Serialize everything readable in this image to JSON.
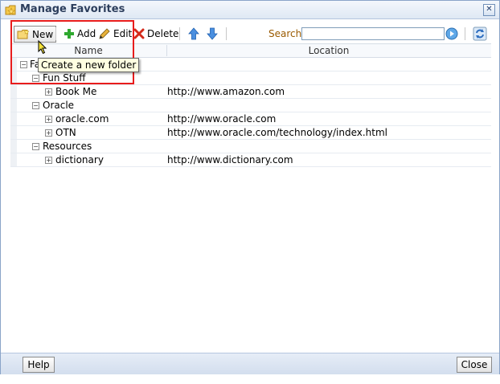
{
  "dialog": {
    "title": "Manage Favorites",
    "close_icon": "close-icon"
  },
  "toolbar": {
    "new_label": "New",
    "add_label": "Add",
    "edit_label": "Edit",
    "delete_label": "Delete",
    "search_label": "Search",
    "search_value": "",
    "icons": [
      "new-folder-icon",
      "add-icon",
      "edit-icon",
      "delete-icon",
      "move-up-icon",
      "move-down-icon",
      "go-icon",
      "refresh-icon"
    ]
  },
  "tooltip": {
    "text": "Create a new folder"
  },
  "table": {
    "headers": {
      "name": "Name",
      "location": "Location"
    },
    "root": {
      "name": "Fa",
      "toggle": "−"
    },
    "rows": [
      {
        "name": "Fun Stuff",
        "location": "",
        "toggle": "−",
        "level": 1
      },
      {
        "name": "Book Me",
        "location": "http://www.amazon.com",
        "toggle": "+",
        "level": 2
      },
      {
        "name": "Oracle",
        "location": "",
        "toggle": "−",
        "level": 1
      },
      {
        "name": "oracle.com",
        "location": "http://www.oracle.com",
        "toggle": "+",
        "level": 2
      },
      {
        "name": "OTN",
        "location": "http://www.oracle.com/technology/index.html",
        "toggle": "+",
        "level": 2
      },
      {
        "name": "Resources",
        "location": "",
        "toggle": "−",
        "level": 1
      },
      {
        "name": "dictionary",
        "location": "http://www.dictionary.com",
        "toggle": "+",
        "level": 2
      }
    ]
  },
  "footer": {
    "help_label": "Help",
    "close_label": "Close"
  },
  "colors": {
    "highlight": "#e81c1c",
    "search_label": "#9a5a00",
    "title_bar": "#dfe8f4"
  }
}
